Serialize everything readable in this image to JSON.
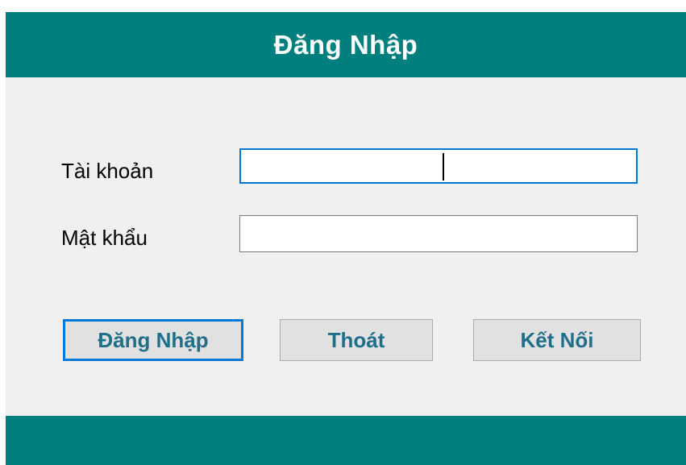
{
  "header": {
    "title": "Đăng Nhập"
  },
  "form": {
    "username_label": "Tài khoản",
    "username_value": "",
    "password_label": "Mật khẩu",
    "password_value": ""
  },
  "buttons": {
    "login_label": "Đăng Nhập",
    "exit_label": "Thoát",
    "connect_label": "Kết Nối"
  },
  "colors": {
    "header_bg": "#007f7f",
    "window_bg": "#f0f0f0",
    "focus_border": "#0078d7",
    "button_text": "#1f6f8b"
  }
}
